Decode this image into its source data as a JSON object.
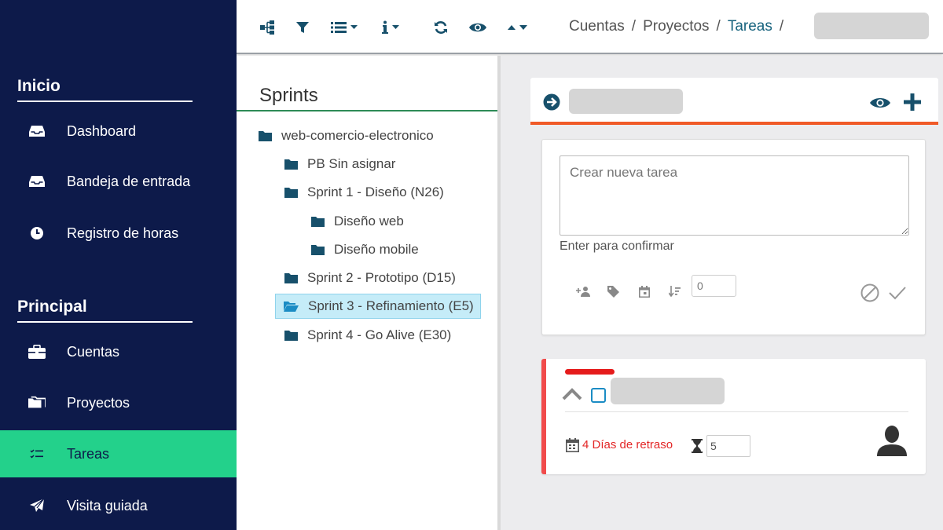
{
  "sidebar": {
    "sections": [
      {
        "title": "Inicio"
      },
      {
        "title": "Principal"
      }
    ],
    "items": [
      {
        "label": "Dashboard",
        "icon": "inbox-icon"
      },
      {
        "label": "Bandeja de entrada",
        "icon": "inbox-icon"
      },
      {
        "label": "Registro de horas",
        "icon": "clock-icon"
      },
      {
        "label": "Cuentas",
        "icon": "briefcase-icon"
      },
      {
        "label": "Proyectos",
        "icon": "folders-icon"
      },
      {
        "label": "Tareas",
        "icon": "task-list-icon",
        "active": true
      },
      {
        "label": "Visita guiada",
        "icon": "paper-plane-icon"
      }
    ],
    "active_color": "#23d18b",
    "background_color": "#0d1a4a"
  },
  "toolbar": {
    "icons": [
      "sitemap-icon",
      "filter-icon",
      "list-dropdown-icon",
      "info-dropdown-icon",
      "refresh-icon",
      "eye-icon",
      "sort-icon"
    ]
  },
  "breadcrumb": {
    "items": [
      "Cuentas",
      "Proyectos",
      "Tareas"
    ],
    "separator": "/"
  },
  "sprints": {
    "title": "Sprints",
    "tree": [
      {
        "label": "web-comercio-electronico",
        "level": 0
      },
      {
        "label": "PB Sin asignar",
        "level": 1
      },
      {
        "label": "Sprint 1 - Diseño (N26)",
        "level": 1
      },
      {
        "label": "Diseño web",
        "level": 2
      },
      {
        "label": "Diseño mobile",
        "level": 2
      },
      {
        "label": "Sprint 2 - Prototipo (D15)",
        "level": 1
      },
      {
        "label": "Sprint 3 - Refinamiento (E5)",
        "level": 1,
        "selected": true
      },
      {
        "label": "Sprint 4 - Go Alive (E30)",
        "level": 1
      }
    ]
  },
  "new_task": {
    "placeholder": "Crear nueva tarea",
    "hint": "Enter para confirmar",
    "estimate_value": "0",
    "tools": [
      "add-user-icon",
      "tag-icon",
      "calendar-icon",
      "sort-amount-icon"
    ]
  },
  "task": {
    "delay_text": "4 Días de retraso",
    "hours_value": "5",
    "priority_color": "#e51b1b"
  },
  "colors": {
    "accent": "#f05a28",
    "icon_teal": "#17506b"
  }
}
